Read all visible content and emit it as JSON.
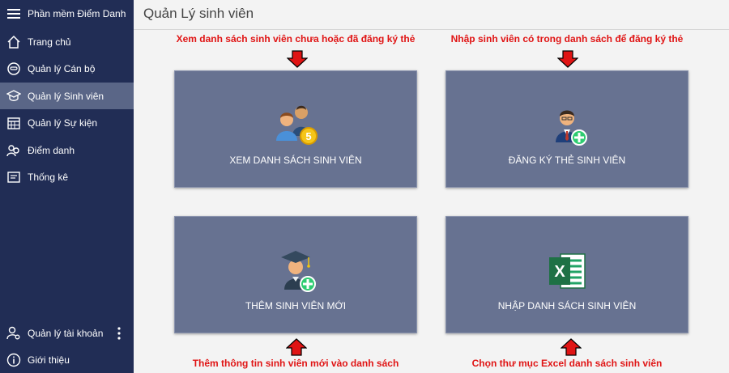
{
  "app": {
    "title": "Phần mềm Điểm Danh"
  },
  "sidebar": {
    "items": [
      {
        "label": "Trang chủ"
      },
      {
        "label": "Quản lý Cán bộ"
      },
      {
        "label": "Quản lý Sinh viên"
      },
      {
        "label": "Quản lý Sự kiện"
      },
      {
        "label": "Điểm danh"
      },
      {
        "label": "Thống kê"
      }
    ],
    "bottom": [
      {
        "label": "Quản lý tài khoản"
      },
      {
        "label": "Giới thiệu"
      }
    ],
    "active_item": "Quản lý Sinh viên"
  },
  "header": {
    "title": "Quản Lý sinh viên"
  },
  "tiles": [
    {
      "label": "XEM DANH SÁCH SINH VIÊN",
      "caption": "Xem danh sách sinh viên chưa hoặc đã đăng ký thẻ",
      "icon": "students-coin-icon"
    },
    {
      "label": "ĐĂNG KÝ THẺ SINH VIÊN",
      "caption": "Nhập sinh viên có trong danh sách để đăng ký thẻ",
      "icon": "person-add-icon"
    },
    {
      "label": "THÊM SINH VIÊN MỚI",
      "caption": "Thêm thông tin sinh viên mới vào danh sách",
      "icon": "graduate-add-icon"
    },
    {
      "label": "NHẬP DANH SÁCH SINH VIÊN",
      "caption": "Chọn thư mục Excel danh sách sinh viên",
      "icon": "excel-icon"
    }
  ],
  "colors": {
    "sidebar_bg": "#212d55",
    "sidebar_active": "#5a6687",
    "tile_bg": "#677291",
    "caption_red": "#e01414",
    "arrow_red": "#e01414"
  }
}
